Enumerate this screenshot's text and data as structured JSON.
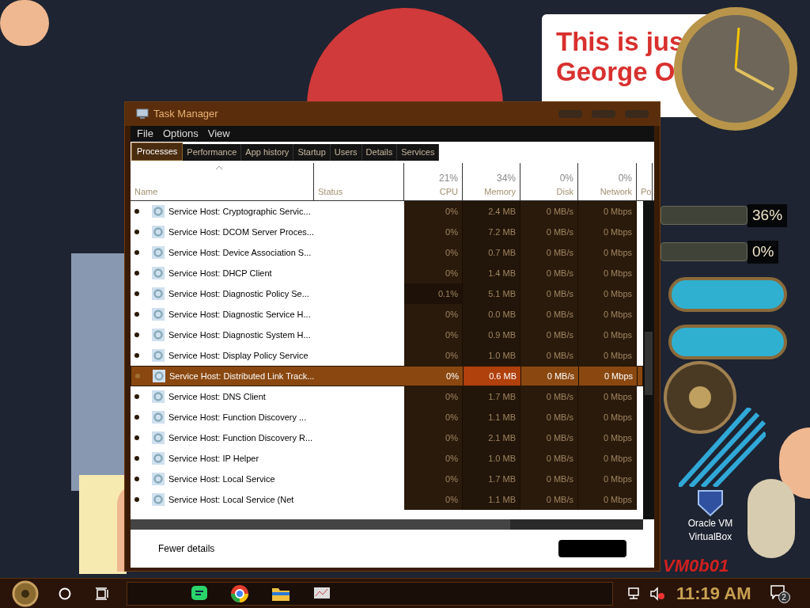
{
  "desktop": {
    "note_lines": [
      "This is jus",
      "George O"
    ],
    "gauges": [
      {
        "reading": "36%"
      },
      {
        "reading": "0%"
      }
    ],
    "icons": [
      {
        "label": "Oracle VM VirtualBox"
      }
    ],
    "banner": "VM0b01"
  },
  "window": {
    "title": "Task Manager"
  },
  "menu": [
    "File",
    "Options",
    "View"
  ],
  "tabs": [
    {
      "label": "Processes",
      "selected": true
    },
    {
      "label": "Performance",
      "selected": false
    },
    {
      "label": "App history",
      "selected": false
    },
    {
      "label": "Startup",
      "selected": false
    },
    {
      "label": "Users",
      "selected": false
    },
    {
      "label": "Details",
      "selected": false
    },
    {
      "label": "Services",
      "selected": false
    }
  ],
  "table": {
    "columns": [
      {
        "label": "Name"
      },
      {
        "label": "Status"
      },
      {
        "label": "CPU",
        "total": "21%"
      },
      {
        "label": "Memory",
        "total": "34%"
      },
      {
        "label": "Disk",
        "total": "0%"
      },
      {
        "label": "Network",
        "total": "0%"
      },
      {
        "label": "Po"
      }
    ],
    "rows": [
      {
        "name": "Service Host: Cryptographic Servic...",
        "cpu": "0%",
        "memory": "2.4 MB",
        "disk": "0 MB/s",
        "network": "0 Mbps",
        "selected": false
      },
      {
        "name": "Service Host: DCOM Server Proces...",
        "cpu": "0%",
        "memory": "7.2 MB",
        "disk": "0 MB/s",
        "network": "0 Mbps",
        "selected": false
      },
      {
        "name": "Service Host: Device Association S...",
        "cpu": "0%",
        "memory": "0.7 MB",
        "disk": "0 MB/s",
        "network": "0 Mbps",
        "selected": false
      },
      {
        "name": "Service Host: DHCP Client",
        "cpu": "0%",
        "memory": "1.4 MB",
        "disk": "0 MB/s",
        "network": "0 Mbps",
        "selected": false
      },
      {
        "name": "Service Host: Diagnostic Policy Se...",
        "cpu": "0.1%",
        "memory": "5.1 MB",
        "disk": "0 MB/s",
        "network": "0 Mbps",
        "selected": false
      },
      {
        "name": "Service Host: Diagnostic Service H...",
        "cpu": "0%",
        "memory": "0.0 MB",
        "disk": "0 MB/s",
        "network": "0 Mbps",
        "selected": false
      },
      {
        "name": "Service Host: Diagnostic System H...",
        "cpu": "0%",
        "memory": "0.9 MB",
        "disk": "0 MB/s",
        "network": "0 Mbps",
        "selected": false
      },
      {
        "name": "Service Host: Display Policy Service",
        "cpu": "0%",
        "memory": "1.0 MB",
        "disk": "0 MB/s",
        "network": "0 Mbps",
        "selected": false
      },
      {
        "name": "Service Host: Distributed Link Track...",
        "cpu": "0%",
        "memory": "0.6 MB",
        "disk": "0 MB/s",
        "network": "0 Mbps",
        "selected": true
      },
      {
        "name": "Service Host: DNS Client",
        "cpu": "0%",
        "memory": "1.7 MB",
        "disk": "0 MB/s",
        "network": "0 Mbps",
        "selected": false
      },
      {
        "name": "Service Host: Function Discovery ...",
        "cpu": "0%",
        "memory": "1.1 MB",
        "disk": "0 MB/s",
        "network": "0 Mbps",
        "selected": false
      },
      {
        "name": "Service Host: Function Discovery R...",
        "cpu": "0%",
        "memory": "2.1 MB",
        "disk": "0 MB/s",
        "network": "0 Mbps",
        "selected": false
      },
      {
        "name": "Service Host: IP Helper",
        "cpu": "0%",
        "memory": "1.0 MB",
        "disk": "0 MB/s",
        "network": "0 Mbps",
        "selected": false
      },
      {
        "name": "Service Host: Local Service",
        "cpu": "0%",
        "memory": "1.7 MB",
        "disk": "0 MB/s",
        "network": "0 Mbps",
        "selected": false
      },
      {
        "name": "Service Host: Local Service (Net",
        "cpu": "0%",
        "memory": "1.1 MB",
        "disk": "0 MB/s",
        "network": "0 Mbps",
        "selected": false
      }
    ]
  },
  "footer": {
    "link": "Fewer details"
  },
  "taskbar": {
    "clock": "11:19 AM",
    "notification_count": "2"
  }
}
